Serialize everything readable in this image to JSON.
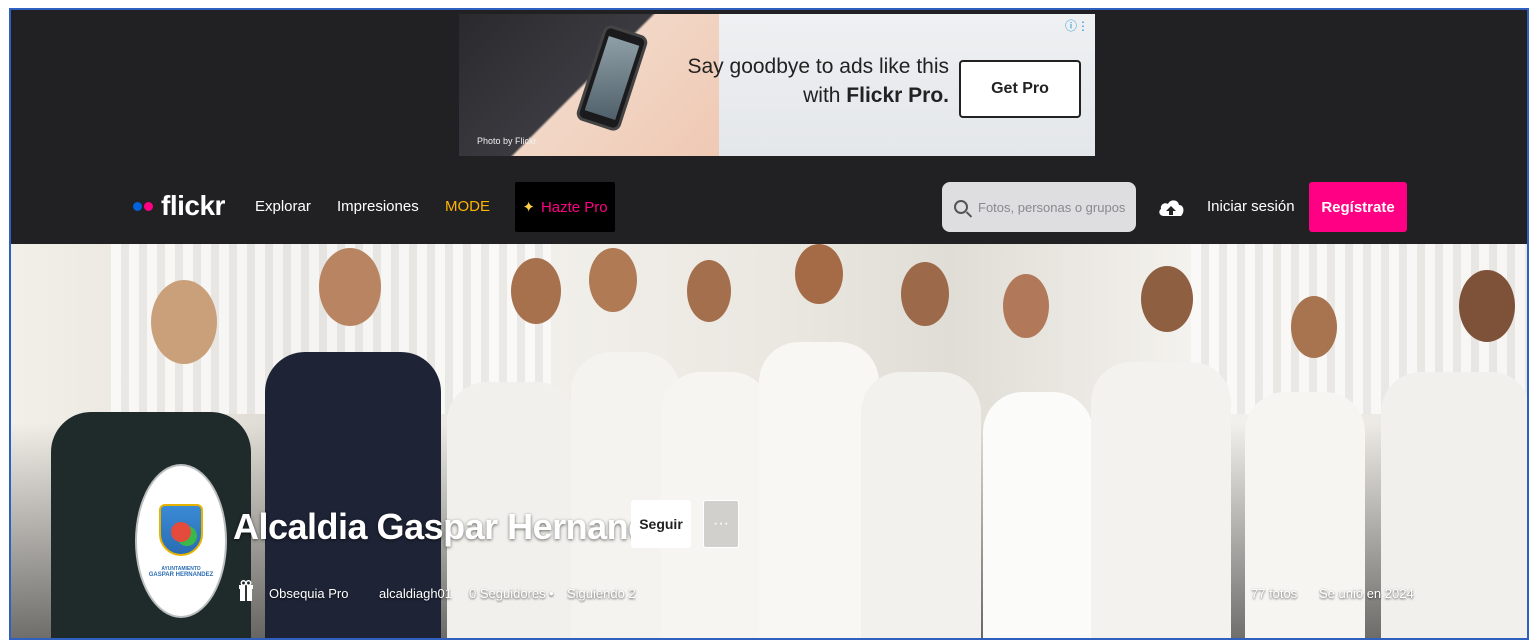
{
  "ad": {
    "photo_credit": "Photo by Flickr",
    "text_line1": "Say goodbye to ads like this",
    "text_line2_prefix": "with ",
    "text_line2_brand": "Flickr Pro.",
    "button": "Get Pro",
    "info_badge": "ⓘ⋮"
  },
  "nav": {
    "logo_text": "flickr",
    "logo_colors": [
      "#0063dc",
      "#ff0084"
    ],
    "links": [
      "Explorar",
      "Impresiones",
      "MODE"
    ],
    "mode_color": "#ffb400",
    "pro_label": "Hazte Pro",
    "search_placeholder": "Fotos, personas o grupos",
    "signin": "Iniciar sesión",
    "signup": "Regístrate"
  },
  "profile": {
    "name": "Alcaldia Gaspar Hernandez",
    "follow_button": "Seguir",
    "more_button": "···",
    "avatar_caption_top": "AYUNTAMIENTO",
    "avatar_caption_main": "GASPAR HERNANDEZ",
    "gift_label": "Obsequia Pro",
    "username": "alcaldiagh01",
    "followers": "0 Seguidores",
    "separator": "•",
    "following": "Siguiendo 2",
    "photos": "77 fotos",
    "joined": "Se unió en 2024"
  }
}
